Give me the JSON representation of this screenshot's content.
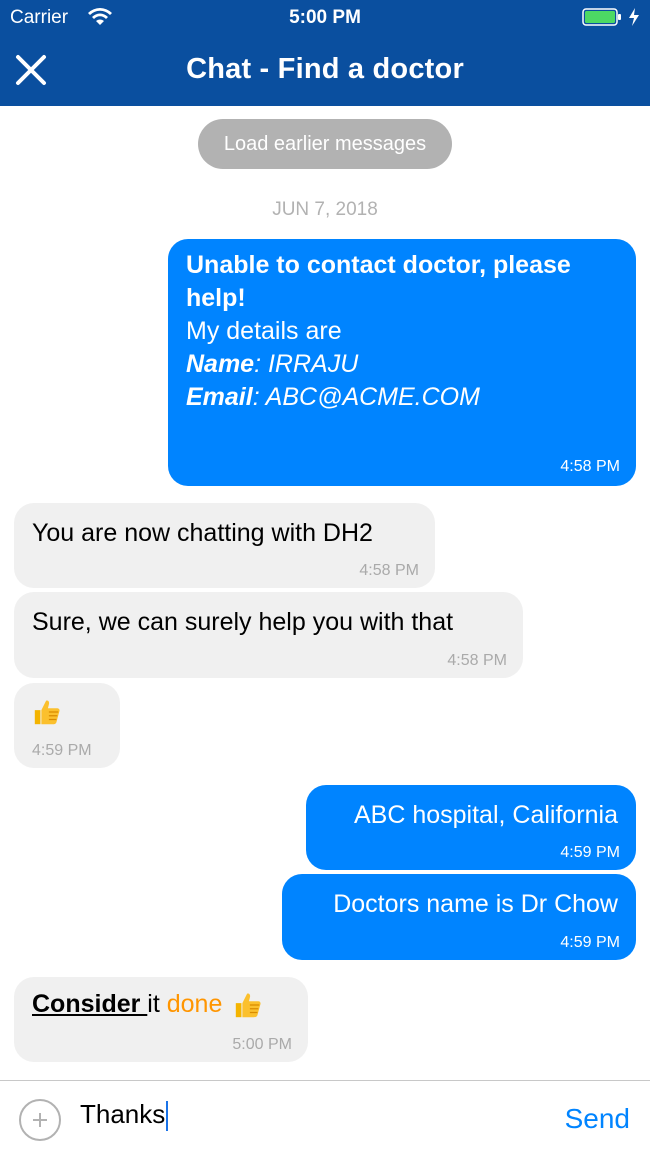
{
  "status_bar": {
    "carrier": "Carrier",
    "time": "5:00 PM"
  },
  "nav": {
    "title": "Chat - Find a doctor"
  },
  "load_earlier": "Load earlier messages",
  "date_separator": "JUN 7, 2018",
  "messages": {
    "m1": {
      "line1": "Unable to contact doctor, please help!",
      "line2": "My details are",
      "name_label": "Name",
      "name_value": ": IRRAJU",
      "email_label": "Email",
      "email_value": ": ABC@ACME.COM",
      "time": "4:58 PM"
    },
    "m2": {
      "text": "You are now chatting with DH2",
      "time": "4:58 PM"
    },
    "m3": {
      "text": "Sure, we can surely help you with that",
      "time": "4:58 PM"
    },
    "m4": {
      "text": "",
      "time": "4:59 PM"
    },
    "m5": {
      "text": "ABC hospital, California",
      "time": "4:59 PM"
    },
    "m6": {
      "text": "Doctors name is Dr Chow",
      "time": "4:59 PM"
    },
    "m7": {
      "link": "Consider ",
      "mid": "it ",
      "highlight": "done",
      "time": "5:00 PM"
    }
  },
  "composer": {
    "value": "Thanks",
    "send_label": "Send"
  },
  "colors": {
    "nav": "#0a4f9f",
    "outgoing": "#0084ff",
    "incoming": "#f0f0f0",
    "highlight": "#ff9500"
  }
}
